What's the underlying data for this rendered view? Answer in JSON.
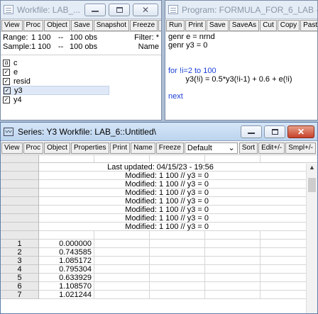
{
  "workfile": {
    "title": "Workfile: LAB_...",
    "toolbar": [
      "View",
      "Proc",
      "Object",
      "Save",
      "Snapshot",
      "Freeze",
      "D"
    ],
    "range_label": "Range:",
    "range_value": "1 100",
    "range_sep": "--",
    "range_obs": "100 obs",
    "filter": "Filter: *",
    "sample_label": "Sample:",
    "sample_value": "1 100",
    "sample_sep": "--",
    "sample_obs": "100 obs",
    "name_label": "Name",
    "objects": [
      {
        "icon": "alpha-icon",
        "name": "c"
      },
      {
        "icon": "check-icon",
        "name": "e"
      },
      {
        "icon": "check-icon",
        "name": "resid"
      },
      {
        "icon": "check-icon",
        "name": "y3",
        "selected": true
      },
      {
        "icon": "check-icon",
        "name": "y4"
      }
    ]
  },
  "program": {
    "title": "Program: FORMULA_FOR_6_LAB - (d",
    "toolbar": [
      "Run",
      "Print",
      "Save",
      "SaveAs",
      "Cut",
      "Copy",
      "Paste"
    ],
    "lines": [
      {
        "text": "genr e = nrnd",
        "blue": false
      },
      {
        "text": "genr y3 = 0",
        "blue": false
      },
      {
        "text": "",
        "blue": false
      },
      {
        "text": "",
        "blue": false
      },
      {
        "text": "for !i=2 to 100",
        "blue": true
      },
      {
        "text": "        y3(!i) = 0.5*y3(!i-1) + 0.6 + e(!i)",
        "blue": false
      },
      {
        "text": "",
        "blue": false
      },
      {
        "text": "next",
        "blue": true
      }
    ]
  },
  "series": {
    "title": "Series: Y3   Workfile: LAB_6::Untitled\\",
    "toolbar": [
      "View",
      "Proc",
      "Object",
      "Properties",
      "Print",
      "Name",
      "Freeze"
    ],
    "display_select": "Default",
    "toolbar_right": [
      "Sort",
      "Edit+/-",
      "Smpl+/-"
    ],
    "last_updated": "Last updated: 04/15/23 - 19:56",
    "modified": [
      "Modified: 1 100 // y3 = 0",
      "Modified: 1 100 // y3 = 0",
      "Modified: 1 100 // y3 = 0",
      "Modified: 1 100 // y3 = 0",
      "Modified: 1 100 // y3 = 0",
      "Modified: 1 100 // y3 = 0",
      "Modified: 1 100 // y3 = 0"
    ],
    "rows": [
      {
        "n": "1",
        "v": "0.000000"
      },
      {
        "n": "2",
        "v": "0.743585"
      },
      {
        "n": "3",
        "v": "1.085172"
      },
      {
        "n": "4",
        "v": "0.795304"
      },
      {
        "n": "5",
        "v": "0.633929"
      },
      {
        "n": "6",
        "v": "1.108570"
      },
      {
        "n": "7",
        "v": "1.021244"
      }
    ]
  }
}
